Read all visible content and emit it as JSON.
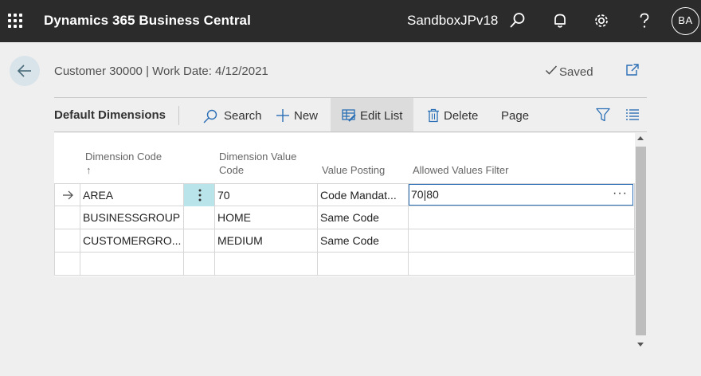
{
  "topbar": {
    "app_title": "Dynamics 365 Business Central",
    "environment": "SandboxJPv18",
    "avatar_initials": "BA"
  },
  "page": {
    "title": "Customer 30000 | Work Date: 4/12/2021",
    "saved_label": "Saved"
  },
  "actionbar": {
    "title": "Default Dimensions",
    "search_label": "Search",
    "new_label": "New",
    "edit_list_label": "Edit List",
    "delete_label": "Delete",
    "page_label": "Page"
  },
  "grid": {
    "headers": {
      "dimension_code": "Dimension Code",
      "dimension_value_code_1": "Dimension Value",
      "dimension_value_code_2": "Code",
      "value_posting": "Value Posting",
      "allowed_values_filter": "Allowed Values Filter"
    },
    "rows": [
      {
        "dimension_code": "AREA",
        "dimension_value_code": "70",
        "value_posting": "Code Mandat...",
        "allowed_values_filter": "70|80"
      },
      {
        "dimension_code": "BUSINESSGROUP",
        "dimension_value_code": "HOME",
        "value_posting": "Same Code",
        "allowed_values_filter": ""
      },
      {
        "dimension_code": "CUSTOMERGRO...",
        "dimension_value_code": "MEDIUM",
        "value_posting": "Same Code",
        "allowed_values_filter": ""
      }
    ]
  },
  "colors": {
    "topbar_bg": "#2b2b2b",
    "selected_cell": "#b9e5ea",
    "focus_border": "#2a6fb5",
    "back_button_bg": "#d8e4ea"
  }
}
